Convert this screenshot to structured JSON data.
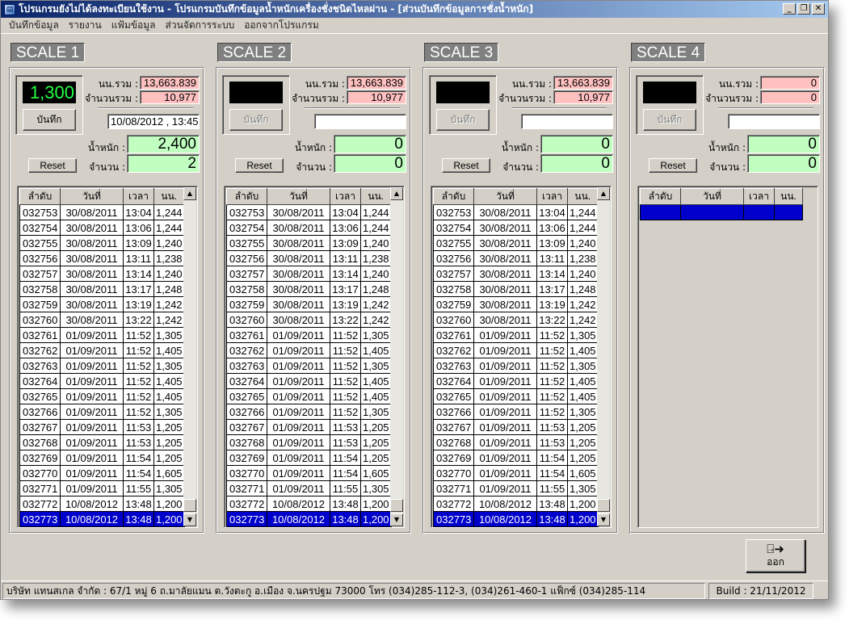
{
  "window": {
    "title": "โปรแกรมยังไม่ได้ลงทะเบียนใช้งาน - โปรแกรมบันทึกข้อมูลน้ำหนักเครื่องชั่งชนิดไหลผ่าน - [ส่วนบันทึกข้อมูลการชั่งน้ำหนัก]",
    "minimize": "_",
    "restore": "❐",
    "close": "✕"
  },
  "menu": [
    "บันทึกข้อมูล",
    "รายงาน",
    "แฟ้มข้อมูล",
    "ส่วนจัดการระบบ",
    "ออกจากโปรแกรม"
  ],
  "labels": {
    "total_weight": "นน.รวม :",
    "total_count": "จำนวนรวม :",
    "weight": "น้ำหนัก :",
    "count": "จำนวน :",
    "save": "บันทึก",
    "reset": "Reset"
  },
  "columns": [
    "ลำดับ",
    "วันที่",
    "เวลา",
    "นน."
  ],
  "scales": [
    {
      "name": "SCALE 1",
      "display": "1,300",
      "total_weight": "13,663.839",
      "total_count": "10,977",
      "datetime": "10/08/2012 , 13:45",
      "weight": "2,400",
      "count": "2",
      "save_enabled": true
    },
    {
      "name": "SCALE 2",
      "display": "",
      "total_weight": "13,663.839",
      "total_count": "10,977",
      "datetime": "",
      "weight": "0",
      "count": "0",
      "save_enabled": false
    },
    {
      "name": "SCALE 3",
      "display": "",
      "total_weight": "13,663.839",
      "total_count": "10,977",
      "datetime": "",
      "weight": "0",
      "count": "0",
      "save_enabled": false
    },
    {
      "name": "SCALE 4",
      "display": "",
      "total_weight": "0",
      "total_count": "0",
      "datetime": "",
      "weight": "0",
      "count": "0",
      "save_enabled": false
    }
  ],
  "rows": [
    [
      "032753",
      "30/08/2011",
      "13:04",
      "1,244"
    ],
    [
      "032754",
      "30/08/2011",
      "13:06",
      "1,244"
    ],
    [
      "032755",
      "30/08/2011",
      "13:09",
      "1,240"
    ],
    [
      "032756",
      "30/08/2011",
      "13:11",
      "1,238"
    ],
    [
      "032757",
      "30/08/2011",
      "13:14",
      "1,240"
    ],
    [
      "032758",
      "30/08/2011",
      "13:17",
      "1,248"
    ],
    [
      "032759",
      "30/08/2011",
      "13:19",
      "1,242"
    ],
    [
      "032760",
      "30/08/2011",
      "13:22",
      "1,242"
    ],
    [
      "032761",
      "01/09/2011",
      "11:52",
      "1,305"
    ],
    [
      "032762",
      "01/09/2011",
      "11:52",
      "1,405"
    ],
    [
      "032763",
      "01/09/2011",
      "11:52",
      "1,305"
    ],
    [
      "032764",
      "01/09/2011",
      "11:52",
      "1,405"
    ],
    [
      "032765",
      "01/09/2011",
      "11:52",
      "1,405"
    ],
    [
      "032766",
      "01/09/2011",
      "11:52",
      "1,305"
    ],
    [
      "032767",
      "01/09/2011",
      "11:53",
      "1,205"
    ],
    [
      "032768",
      "01/09/2011",
      "11:53",
      "1,205"
    ],
    [
      "032769",
      "01/09/2011",
      "11:54",
      "1,205"
    ],
    [
      "032770",
      "01/09/2011",
      "11:54",
      "1,605"
    ],
    [
      "032771",
      "01/09/2011",
      "11:55",
      "1,305"
    ],
    [
      "032772",
      "10/08/2012",
      "13:48",
      "1,200"
    ],
    [
      "032773",
      "10/08/2012",
      "13:48",
      "1,200"
    ]
  ],
  "selected_row": 20,
  "exit": {
    "label": "ออก",
    "icon": "exit-door-icon"
  },
  "status": {
    "company": "บริษัท แทนสเกล จำกัด  :  67/1 หมู่ 6 ถ.มาลัยแมน ต.วังตะกู อ.เมือง จ.นครปฐม 73000  โทร (034)285-112-3, (034)261-460-1  แฟ็กซ์ (034)285-114",
    "build": "Build : 21/11/2012"
  },
  "colors": {
    "selection": "#0000cc",
    "led_text": "#22ff44",
    "total_box": "#ffc0c0",
    "value_box": "#c0ffc0"
  }
}
